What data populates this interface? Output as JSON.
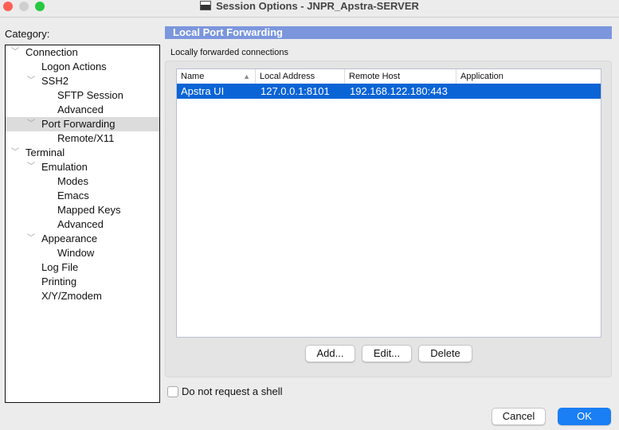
{
  "window": {
    "title": "Session Options - JNPR_Apstra-SERVER"
  },
  "category": {
    "label": "Category:",
    "items": [
      {
        "label": "Connection",
        "level": 0,
        "expanded": true
      },
      {
        "label": "Logon Actions",
        "level": 1
      },
      {
        "label": "SSH2",
        "level": 1,
        "expanded": true
      },
      {
        "label": "SFTP Session",
        "level": 2
      },
      {
        "label": "Advanced",
        "level": 2
      },
      {
        "label": "Port Forwarding",
        "level": 1,
        "expanded": true,
        "selected": true
      },
      {
        "label": "Remote/X11",
        "level": 2
      },
      {
        "label": "Terminal",
        "level": 0,
        "expanded": true
      },
      {
        "label": "Emulation",
        "level": 1,
        "expanded": true
      },
      {
        "label": "Modes",
        "level": 2
      },
      {
        "label": "Emacs",
        "level": 2
      },
      {
        "label": "Mapped Keys",
        "level": 2
      },
      {
        "label": "Advanced",
        "level": 2
      },
      {
        "label": "Appearance",
        "level": 1,
        "expanded": true
      },
      {
        "label": "Window",
        "level": 2
      },
      {
        "label": "Log File",
        "level": 1
      },
      {
        "label": "Printing",
        "level": 1
      },
      {
        "label": "X/Y/Zmodem",
        "level": 1
      }
    ]
  },
  "panel": {
    "header": "Local Port Forwarding",
    "subtitle": "Locally forwarded connections",
    "columns": [
      "Name",
      "Local Address",
      "Remote Host",
      "Application"
    ],
    "sort_indicator": "▲",
    "rows": [
      {
        "name": "Apstra UI",
        "local": "127.0.0.1:8101",
        "remote": "192.168.122.180:443",
        "app": ""
      }
    ],
    "add": "Add...",
    "edit": "Edit...",
    "delete": "Delete"
  },
  "no_shell": {
    "label": "Do not request a shell",
    "checked": false
  },
  "footer": {
    "cancel": "Cancel",
    "ok": "OK"
  }
}
